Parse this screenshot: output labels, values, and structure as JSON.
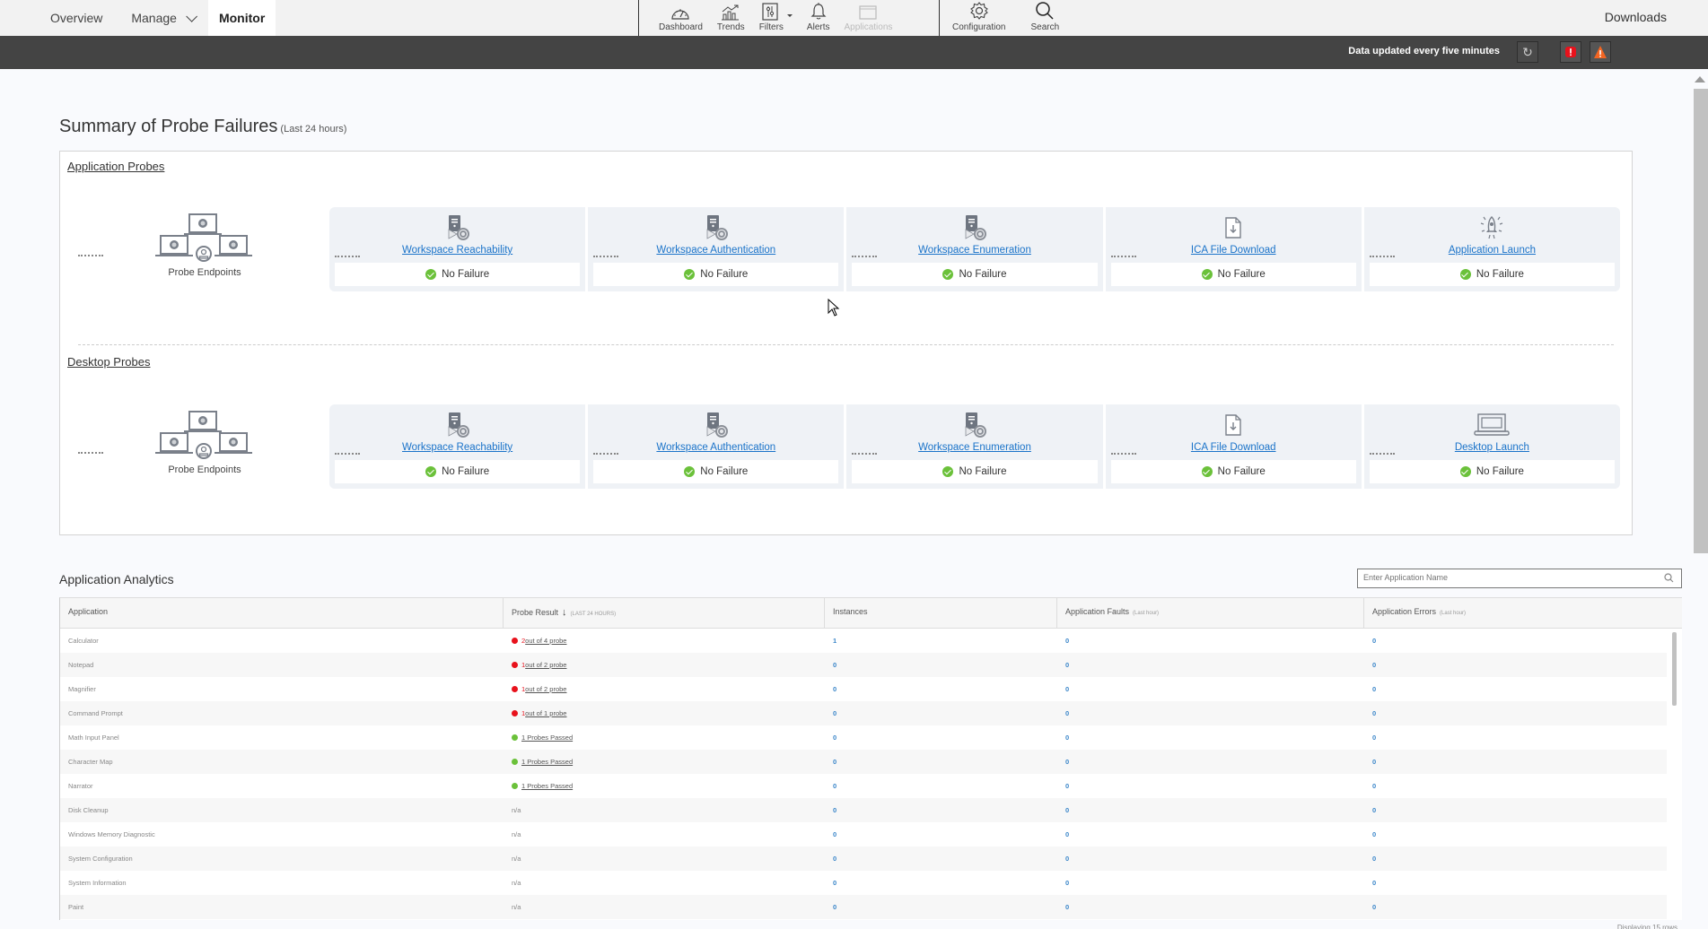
{
  "topnav": {
    "links": [
      {
        "label": "Overview",
        "active": false
      },
      {
        "label": "Manage",
        "active": false,
        "has_dropdown": true
      },
      {
        "label": "Monitor",
        "active": true
      }
    ],
    "tools": [
      {
        "label": "Dashboard",
        "icon": "dashboard-gauge-icon"
      },
      {
        "label": "Trends",
        "icon": "trends-chart-icon"
      },
      {
        "label": "Filters",
        "icon": "filters-sliders-icon",
        "has_dropdown": true
      },
      {
        "label": "Alerts",
        "icon": "bell-icon"
      },
      {
        "label": "Applications",
        "icon": "application-window-icon",
        "disabled": true
      }
    ],
    "tools2": [
      {
        "label": "Configuration",
        "icon": "gear-icon"
      },
      {
        "label": "Search",
        "icon": "search-icon"
      }
    ],
    "downloads": "Downloads"
  },
  "statusbar": {
    "message": "Data updated every five minutes",
    "refresh_icon": "refresh-icon",
    "error_icon": "error-alert-icon",
    "warning_icon": "warning-alert-icon"
  },
  "summary": {
    "title": "Summary of Probe Failures",
    "subtitle": "(Last 24 hours)",
    "sections": [
      {
        "title": "Application Probes",
        "endpoint_label": "Probe Endpoints",
        "probes": [
          {
            "name": "Workspace Reachability",
            "status": "No Failure",
            "icon": "workspace-server-icon"
          },
          {
            "name": "Workspace Authentication",
            "status": "No Failure",
            "icon": "workspace-server-icon"
          },
          {
            "name": "Workspace Enumeration",
            "status": "No Failure",
            "icon": "workspace-server-icon"
          },
          {
            "name": "ICA File Download",
            "status": "No Failure",
            "icon": "file-download-icon"
          },
          {
            "name": "Application Launch",
            "status": "No Failure",
            "icon": "rocket-launch-icon"
          }
        ]
      },
      {
        "title": "Desktop Probes",
        "endpoint_label": "Probe Endpoints",
        "probes": [
          {
            "name": "Workspace Reachability",
            "status": "No Failure",
            "icon": "workspace-server-icon"
          },
          {
            "name": "Workspace Authentication",
            "status": "No Failure",
            "icon": "workspace-server-icon"
          },
          {
            "name": "Workspace Enumeration",
            "status": "No Failure",
            "icon": "workspace-server-icon"
          },
          {
            "name": "ICA File Download",
            "status": "No Failure",
            "icon": "file-download-icon"
          },
          {
            "name": "Desktop Launch",
            "status": "No Failure",
            "icon": "laptop-icon"
          }
        ]
      }
    ]
  },
  "analytics": {
    "title": "Application Analytics",
    "search_placeholder": "Enter Application Name",
    "columns": [
      {
        "label": "Application",
        "note": ""
      },
      {
        "label": "Probe Result",
        "note": "(LAST 24 HOURS)",
        "sorted": "desc"
      },
      {
        "label": "Instances",
        "note": ""
      },
      {
        "label": "Application Faults",
        "note": "(Last hour)"
      },
      {
        "label": "Application Errors",
        "note": "(Last hour)"
      }
    ],
    "rows": [
      {
        "app": "Calculator",
        "result_type": "fail",
        "fail_count": "2",
        "result_text": " out of 4 probe",
        "instances": "1",
        "faults": "0",
        "errors": "0"
      },
      {
        "app": "Notepad",
        "result_type": "fail",
        "fail_count": "1",
        "result_text": " out of 2 probe",
        "instances": "0",
        "faults": "0",
        "errors": "0"
      },
      {
        "app": "Magnifier",
        "result_type": "fail",
        "fail_count": "1",
        "result_text": " out of 2 probe",
        "instances": "0",
        "faults": "0",
        "errors": "0"
      },
      {
        "app": "Command Prompt",
        "result_type": "fail",
        "fail_count": "1",
        "result_text": " out of 1 probe",
        "instances": "0",
        "faults": "0",
        "errors": "0"
      },
      {
        "app": "Math Input Panel",
        "result_type": "pass",
        "fail_count": "",
        "result_text": "1 Probes Passed",
        "instances": "0",
        "faults": "0",
        "errors": "0"
      },
      {
        "app": "Character Map",
        "result_type": "pass",
        "fail_count": "",
        "result_text": "1 Probes Passed",
        "instances": "0",
        "faults": "0",
        "errors": "0"
      },
      {
        "app": "Narrator",
        "result_type": "pass",
        "fail_count": "",
        "result_text": "1 Probes Passed",
        "instances": "0",
        "faults": "0",
        "errors": "0"
      },
      {
        "app": "Disk Cleanup",
        "result_type": "na",
        "fail_count": "",
        "result_text": "n/a",
        "instances": "0",
        "faults": "0",
        "errors": "0"
      },
      {
        "app": "Windows Memory Diagnostic",
        "result_type": "na",
        "fail_count": "",
        "result_text": "n/a",
        "instances": "0",
        "faults": "0",
        "errors": "0"
      },
      {
        "app": "System Configuration",
        "result_type": "na",
        "fail_count": "",
        "result_text": "n/a",
        "instances": "0",
        "faults": "0",
        "errors": "0"
      },
      {
        "app": "System Information",
        "result_type": "na",
        "fail_count": "",
        "result_text": "n/a",
        "instances": "0",
        "faults": "0",
        "errors": "0"
      },
      {
        "app": "Paint",
        "result_type": "na",
        "fail_count": "",
        "result_text": "n/a",
        "instances": "0",
        "faults": "0",
        "errors": "0"
      }
    ],
    "footer": "Displaying 15 rows"
  },
  "colors": {
    "link_blue": "#1a73c9",
    "ok_green": "#6bc13a",
    "fail_red": "#e8121c",
    "status_bar": "#444444",
    "warning_orange": "#f26522"
  }
}
